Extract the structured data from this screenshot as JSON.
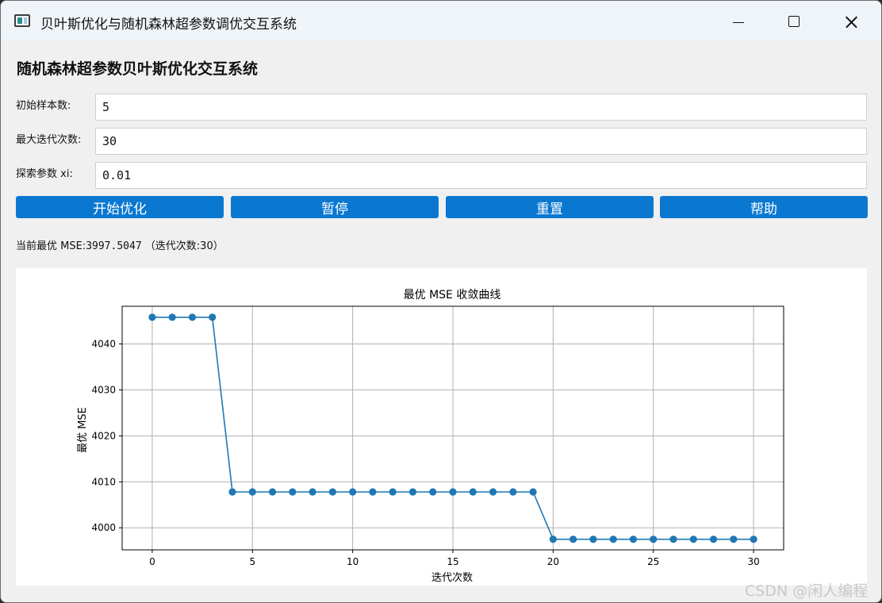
{
  "window": {
    "title": "贝叶斯优化与随机森林超参数调优交互系统"
  },
  "page_title": "随机森林超参数贝叶斯优化交互系统",
  "form": {
    "initial_samples": {
      "label": "初始样本数:",
      "value": "5"
    },
    "max_iterations": {
      "label": "最大迭代次数:",
      "value": "30"
    },
    "xi": {
      "label": "探索参数 xi:",
      "value": "0.01"
    }
  },
  "buttons": {
    "start": "开始优化",
    "pause": "暂停",
    "reset": "重置",
    "help": "帮助"
  },
  "status": {
    "prefix": "当前最优 MSE:",
    "mse": "3997.5047",
    "iter_text": "（迭代次数:30）"
  },
  "chart_data": {
    "type": "line",
    "title": "最优 MSE 收敛曲线",
    "xlabel": "迭代次数",
    "ylabel": "最优 MSE",
    "x": [
      0,
      1,
      2,
      3,
      4,
      5,
      6,
      7,
      8,
      9,
      10,
      11,
      12,
      13,
      14,
      15,
      16,
      17,
      18,
      19,
      20,
      21,
      22,
      23,
      24,
      25,
      26,
      27,
      28,
      29,
      30
    ],
    "y": [
      4045.8,
      4045.8,
      4045.8,
      4045.8,
      4007.8,
      4007.8,
      4007.8,
      4007.8,
      4007.8,
      4007.8,
      4007.8,
      4007.8,
      4007.8,
      4007.8,
      4007.8,
      4007.8,
      4007.8,
      4007.8,
      4007.8,
      4007.8,
      3997.5,
      3997.5,
      3997.5,
      3997.5,
      3997.5,
      3997.5,
      3997.5,
      3997.5,
      3997.5,
      3997.5,
      3997.5
    ],
    "xlim": [
      -1.5,
      31.5
    ],
    "ylim": [
      3995.2,
      4048.2
    ],
    "xticks": [
      0,
      5,
      10,
      15,
      20,
      25,
      30
    ],
    "yticks": [
      4000,
      4010,
      4020,
      4030,
      4040
    ],
    "grid": true,
    "marker": "circle",
    "line_color": "#1f77b4"
  },
  "watermark": "CSDN @闲人编程"
}
